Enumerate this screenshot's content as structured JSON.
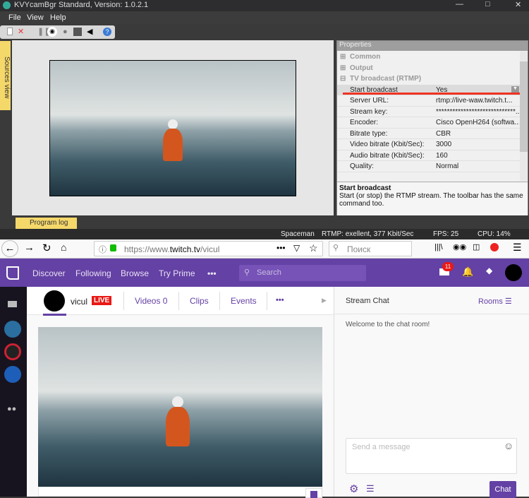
{
  "app": {
    "title": "KVYcamBgr Standard, Version: 1.0.2.1",
    "menu": [
      "File",
      "View",
      "Help"
    ],
    "sources_tab": "Sources view",
    "program_log_tab": "Program log"
  },
  "properties": {
    "title": "Properties",
    "groups": [
      "Common",
      "Output",
      "TV broadcast (RTMP)"
    ],
    "rows": [
      {
        "k": "Start broadcast",
        "v": "Yes"
      },
      {
        "k": "Server URL:",
        "v": "rtmp://live-waw.twitch.t..."
      },
      {
        "k": "Stream key:",
        "v": "*****************************..."
      },
      {
        "k": "Encoder:",
        "v": "Cisco OpenH264 (softwa..."
      },
      {
        "k": "Bitrate type:",
        "v": "CBR"
      },
      {
        "k": "Video bitrate (Kbit/Sec):",
        "v": "3000"
      },
      {
        "k": "Audio bitrate (Kbit/Sec):",
        "v": "160"
      },
      {
        "k": "Quality:",
        "v": "Normal"
      }
    ],
    "desc_title": "Start broadcast",
    "desc_text": "Start (or stop) the RTMP stream. The toolbar has the same command too."
  },
  "status": {
    "scene": "Spaceman",
    "rtmp": "RTMP: exellent, 377 Kbit/Sec",
    "fps": "FPS: 25",
    "cpu": "CPU: 14%"
  },
  "browser": {
    "url_prefix": "https://www.",
    "url_host": "twitch.tv",
    "url_path": "/vicul",
    "search_placeholder": "Поиск"
  },
  "twitch": {
    "nav": [
      "Discover",
      "Following",
      "Browse",
      "Try Prime"
    ],
    "search_placeholder": "Search",
    "badge": "11",
    "channel": {
      "name": "vicul",
      "live": "LIVE",
      "tabs": [
        "Videos 0",
        "Clips",
        "Events"
      ]
    },
    "chat": {
      "title": "Stream Chat",
      "rooms": "Rooms",
      "welcome": "Welcome to the chat room!",
      "placeholder": "Send a message",
      "button": "Chat"
    },
    "accent": "#6441a4"
  }
}
